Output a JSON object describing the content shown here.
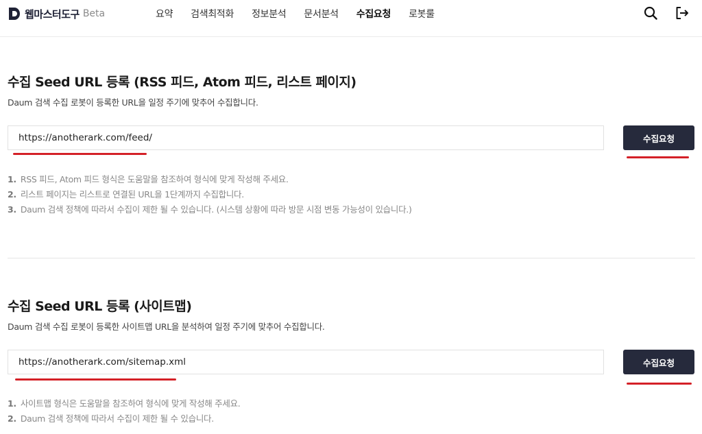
{
  "header": {
    "logo_text": "웹마스터도구",
    "logo_badge": "Beta",
    "nav": [
      {
        "label": "요약",
        "active": false
      },
      {
        "label": "검색최적화",
        "active": false
      },
      {
        "label": "정보분석",
        "active": false
      },
      {
        "label": "문서분석",
        "active": false
      },
      {
        "label": "수집요청",
        "active": true
      },
      {
        "label": "로봇룰",
        "active": false
      }
    ],
    "icons": {
      "search": "search-icon",
      "logout": "logout-icon"
    }
  },
  "section_rss": {
    "title": "수집 Seed URL 등록 (RSS 피드, Atom 피드, 리스트 페이지)",
    "description": "Daum 검색 수집 로봇이 등록한 URL을 일정 주기에 맞추어 수집합니다.",
    "input_value": "https://anotherark.com/feed/",
    "button_label": "수집요청",
    "notes": [
      {
        "num": "1.",
        "text": "RSS 피드, Atom 피드 형식은 도움말을 참조하여 형식에 맞게 작성해 주세요."
      },
      {
        "num": "2.",
        "text": "리스트 페이지는 리스트로 연결된 URL을 1단계까지 수집합니다."
      },
      {
        "num": "3.",
        "text": "Daum 검색 정책에 따라서 수집이 제한 될 수 있습니다. (시스템 상황에 따라 방문 시점 변동 가능성이 있습니다.)"
      }
    ]
  },
  "section_sitemap": {
    "title": "수집 Seed URL 등록 (사이트맵)",
    "description": "Daum 검색 수집 로봇이 등록한 사이트맵 URL을 분석하여 일정 주기에 맞추어 수집합니다.",
    "input_value": "https://anotherark.com/sitemap.xml",
    "button_label": "수집요청",
    "notes": [
      {
        "num": "1.",
        "text": "사이트맵 형식은 도움말을 참조하여 형식에 맞게 작성해 주세요."
      },
      {
        "num": "2.",
        "text": "Daum 검색 정책에 따라서 수집이 제한 될 수 있습니다."
      }
    ]
  },
  "colors": {
    "accent_dark": "#262a3c",
    "annotation_red": "#d42027"
  }
}
